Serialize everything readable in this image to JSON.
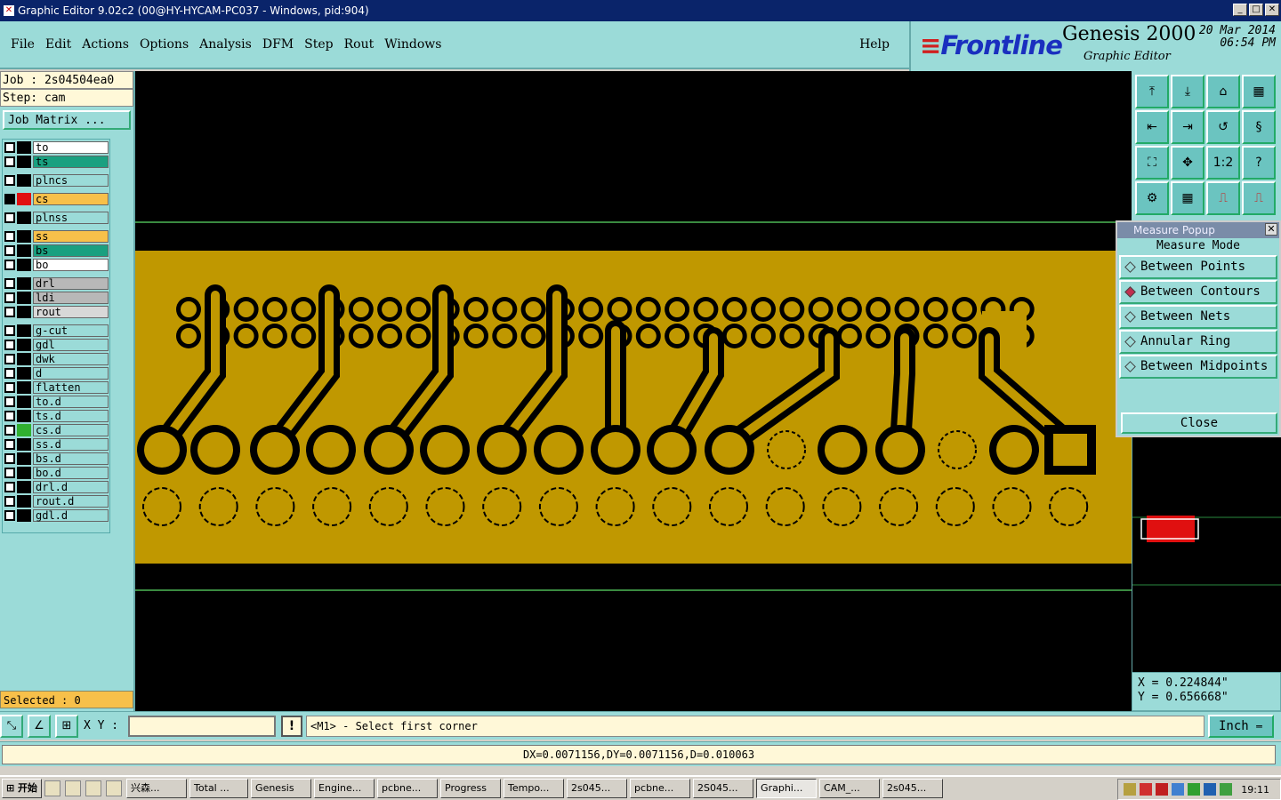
{
  "window": {
    "title": "Graphic Editor 9.02c2 (00@HY-HYCAM-PC037 - Windows, pid:904)"
  },
  "menu": [
    "File",
    "Edit",
    "Actions",
    "Options",
    "Analysis",
    "DFM",
    "Step",
    "Rout",
    "Windows"
  ],
  "menu_help": "Help",
  "logo": {
    "brand": "Frontline",
    "product": "Genesis 2000",
    "subtitle": "Graphic Editor",
    "date": "20 Mar 2014",
    "time": "06:54 PM"
  },
  "job": {
    "job_line": "Job : 2s04504ea0",
    "step_line": "Step: cam",
    "matrix_label": "Job Matrix ..."
  },
  "layers": [
    {
      "name": "to",
      "color": "#ffffff"
    },
    {
      "name": "ts",
      "color": "#1aa080"
    },
    {
      "name": "plncs",
      "color": "#9bdbd8"
    },
    {
      "name": "cs",
      "color": "#f7c04a"
    },
    {
      "name": "plnss",
      "color": "#9bdbd8"
    },
    {
      "name": "ss",
      "color": "#f7c04a"
    },
    {
      "name": "bs",
      "color": "#1aa080"
    },
    {
      "name": "bo",
      "color": "#ffffff"
    },
    {
      "name": "drl",
      "color": "#b8b8b8"
    },
    {
      "name": "ldi",
      "color": "#b8b8b8"
    },
    {
      "name": "rout",
      "color": "#d8d8d8"
    },
    {
      "name": "g-cut",
      "color": "#9bdbd8"
    },
    {
      "name": "gdl",
      "color": "#9bdbd8"
    },
    {
      "name": "dwk",
      "color": "#9bdbd8"
    },
    {
      "name": "d",
      "color": "#9bdbd8"
    },
    {
      "name": "flatten",
      "color": "#9bdbd8"
    },
    {
      "name": "to.d",
      "color": "#9bdbd8"
    },
    {
      "name": "ts.d",
      "color": "#9bdbd8"
    },
    {
      "name": "cs.d",
      "color": "#9bdbd8"
    },
    {
      "name": "ss.d",
      "color": "#9bdbd8"
    },
    {
      "name": "bs.d",
      "color": "#9bdbd8"
    },
    {
      "name": "bo.d",
      "color": "#9bdbd8"
    },
    {
      "name": "drl.d",
      "color": "#9bdbd8"
    },
    {
      "name": "rout.d",
      "color": "#9bdbd8"
    },
    {
      "name": "gdl.d",
      "color": "#9bdbd8"
    }
  ],
  "selected": "Selected : 0",
  "measure": {
    "title": "Measure Popup",
    "heading": "Measure Mode",
    "options": [
      {
        "label": "Between Points",
        "selected": false
      },
      {
        "label": "Between Contours",
        "selected": true
      },
      {
        "label": "Between Nets",
        "selected": false
      },
      {
        "label": "Annular Ring",
        "selected": false
      },
      {
        "label": "Between Midpoints",
        "selected": false
      }
    ],
    "close_label": "Close"
  },
  "coords": {
    "x": "X = 0.224844\"",
    "y": "Y = 0.656668\""
  },
  "bottom": {
    "xy_label": "X Y :",
    "xy_value": "",
    "excl": "!",
    "prompt": "<M1> - Select first corner",
    "unit": "Inch"
  },
  "status_message": "DX=0.0071156,DY=0.0071156,D=0.010063",
  "taskbar": {
    "start": "开始",
    "items": [
      "兴森...",
      "Total ...",
      "Genesis",
      "Engine...",
      "pcbne...",
      "Progress",
      "Tempo...",
      "2s045...",
      "pcbne...",
      "2S045...",
      "Graphi...",
      "CAM_...",
      "2s045..."
    ],
    "active_index": 10,
    "clock": "19:11"
  },
  "colors": {
    "copper": "#c09800",
    "background": "#000000",
    "cyan_panel": "#9bdbd8",
    "selected_layer": "#f7c04a"
  }
}
